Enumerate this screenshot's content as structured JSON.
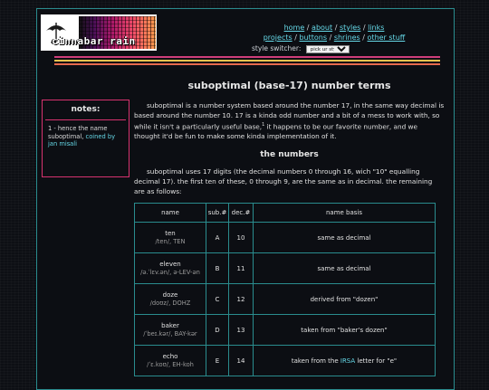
{
  "logo": {
    "text": "cinnabar rain"
  },
  "nav": {
    "row1": [
      "home",
      "about",
      "styles",
      "links"
    ],
    "row2": [
      "projects",
      "buttons",
      "shrines",
      "other stuff"
    ],
    "style_switcher_label": "style switcher:",
    "style_switcher_value": "pick ur style..."
  },
  "colors": {
    "accent": "#2a8c8e",
    "link": "#66d9e8",
    "notes_border": "#d7336f",
    "stripes": [
      "#cf3e7a",
      "#f0c24e",
      "#e86a4e",
      "#d9f0ff"
    ]
  },
  "notes": {
    "heading": "notes:",
    "text": "1 - hence the name suboptimal,",
    "link": "coined by jan misali"
  },
  "main": {
    "title": "suboptimal (base-17) number terms",
    "intro_a": "suboptimal is a number system based around the number 17, in the same way decimal is based around the number 10. 17 is a kinda odd number and a bit of a mess to work with, so while it isn't a particularly useful base,",
    "intro_sup": "1",
    "intro_b": " it happens to be our favorite number, and we thought it'd be fun to make some kinda implementation of it.",
    "section_heading": "the numbers",
    "numbers_para": "suboptimal uses 17 digits (the decimal numbers 0 through 16, wich \"10\" equalling decimal 17). the first ten of these, 0 through 9, are the same as in decimal. the remaining are as follows:"
  },
  "table": {
    "headers": [
      "name",
      "sub.#",
      "dec.#",
      "name basis"
    ],
    "rows": [
      {
        "name": "ten",
        "ipa": "/ten/, TEN",
        "sub": "A",
        "dec": "10",
        "basis": "same as decimal"
      },
      {
        "name": "eleven",
        "ipa": "/ə.ˈlɛv.ən/, ə-LEV-ən",
        "sub": "B",
        "dec": "11",
        "basis": "same as decimal"
      },
      {
        "name": "doze",
        "ipa": "/doʊz/, DOHZ",
        "sub": "C",
        "dec": "12",
        "basis": "derived from \"dozen\""
      },
      {
        "name": "baker",
        "ipa": "/ˈbeɪ.kər/, BAY-kər",
        "sub": "D",
        "dec": "13",
        "basis": "taken from \"baker's dozen\""
      },
      {
        "name": "echo",
        "ipa": "/ˈɛ.koʊ/, EH-koh",
        "sub": "E",
        "dec": "14",
        "basis_pre": "taken from the ",
        "basis_link": "IRSA",
        "basis_post": " letter for \"e\""
      }
    ]
  }
}
